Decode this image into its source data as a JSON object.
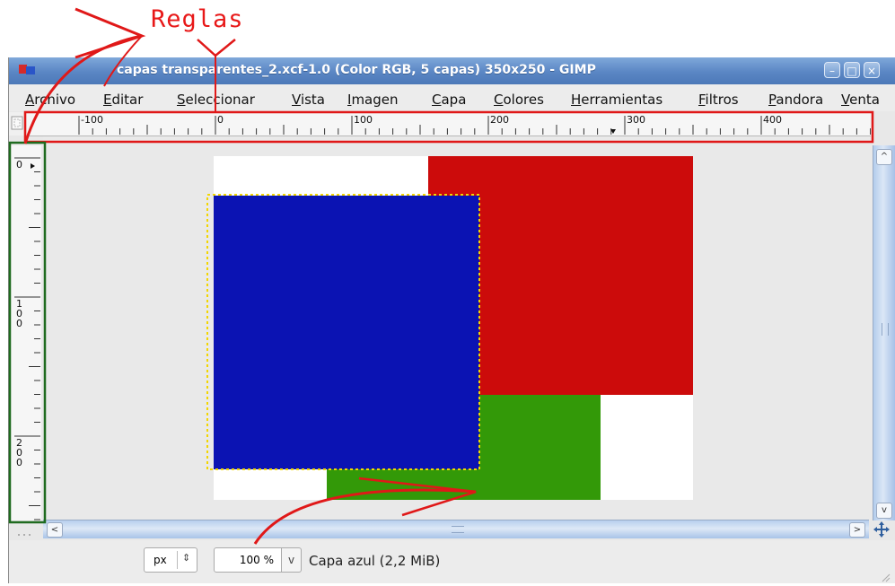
{
  "annotation": {
    "title": "Reglas"
  },
  "window": {
    "title": "capas transparentes_2.xcf-1.0 (Color RGB, 5 capas) 350x250 - GIMP",
    "controls": [
      "minimize",
      "maximize",
      "close"
    ]
  },
  "menu": {
    "items": [
      {
        "mnemonic": "A",
        "rest": "rchivo"
      },
      {
        "mnemonic": "E",
        "rest": "ditar"
      },
      {
        "mnemonic": "S",
        "rest": "eleccionar"
      },
      {
        "mnemonic": "V",
        "rest": "ista"
      },
      {
        "mnemonic": "I",
        "rest": "magen"
      },
      {
        "mnemonic": "C",
        "rest": "apa"
      },
      {
        "mnemonic": "C",
        "rest": "olores"
      },
      {
        "mnemonic": "H",
        "rest": "erramientas"
      },
      {
        "mnemonic": "F",
        "rest": "iltros"
      },
      {
        "mnemonic": "P",
        "rest": "andora"
      },
      {
        "mnemonic": "V",
        "rest": "enta"
      }
    ]
  },
  "rulers": {
    "horizontal_labels": [
      "-100",
      "0",
      "100",
      "200",
      "300",
      "400"
    ],
    "vertical_labels": [
      "0",
      "100",
      "200"
    ]
  },
  "canvas": {
    "colors": {
      "background": "#ffffff",
      "red_layer": "#cc0b0b",
      "green_layer": "#339908",
      "blue_layer": "#0b13b3",
      "selection": "#f2d600"
    }
  },
  "status": {
    "unit": "px",
    "zoom": "100 %",
    "layer_info": "Capa azul (2,2 MiB)"
  },
  "icons": {
    "app": "gimp-icon",
    "navigate": "move-navigate-icon",
    "quickmask": "quick-mask-icon"
  }
}
